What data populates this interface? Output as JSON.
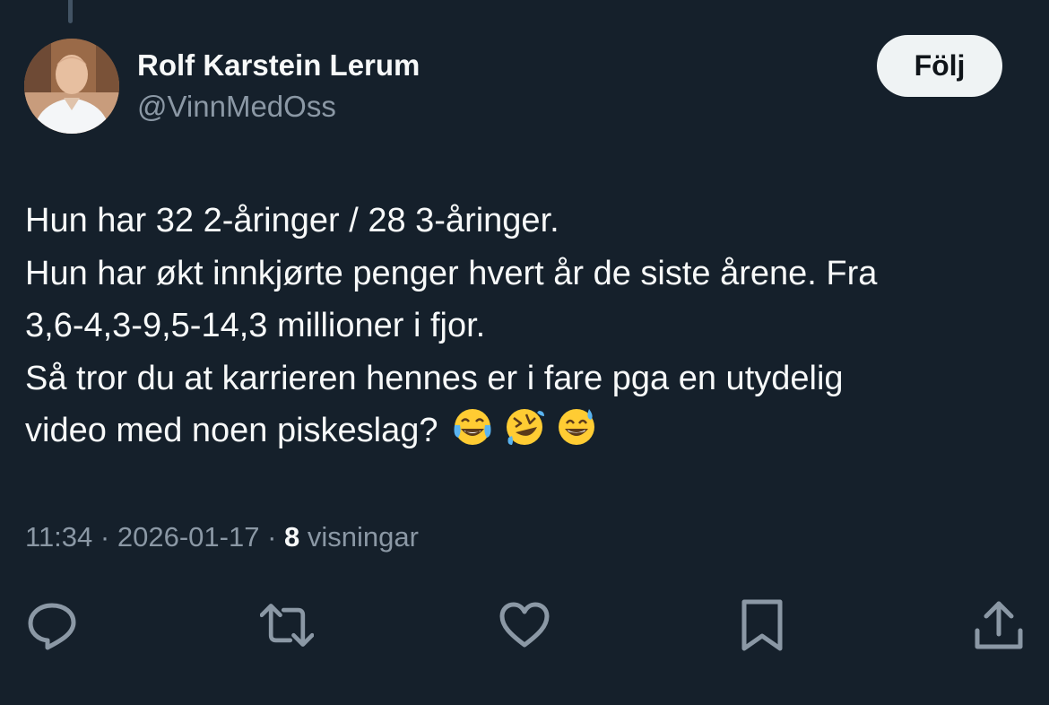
{
  "author": {
    "name": "Rolf Karstein Lerum",
    "handle": "@VinnMedOss"
  },
  "follow_button": {
    "label": "Följ"
  },
  "tweet": {
    "lines": [
      "Hun har 32 2-åringer / 28 3-åringer.",
      "Hun har økt innkjørte penger hvert år de siste årene. Fra",
      "3,6-4,3-9,5-14,3 millioner i fjor.",
      "Så tror du at karrieren hennes er i fare pga en utydelig",
      "video med noen piskeslag?"
    ],
    "emojis": [
      "face-with-tears-of-joy",
      "rolling-on-floor-laughing",
      "grinning-face-with-sweat"
    ]
  },
  "meta": {
    "time": "11:34",
    "separator": "·",
    "date": "2026-01-17",
    "views_count": "8",
    "views_label": "visningar"
  },
  "actions": {
    "icons": [
      "reply-icon",
      "retweet-icon",
      "like-icon",
      "bookmark-icon",
      "share-icon"
    ],
    "icon_color": "#8b98a5"
  },
  "colors": {
    "background": "#15202b",
    "text_primary": "#f7f9f9",
    "text_secondary": "#8b98a5",
    "follow_bg": "#eff3f4"
  }
}
